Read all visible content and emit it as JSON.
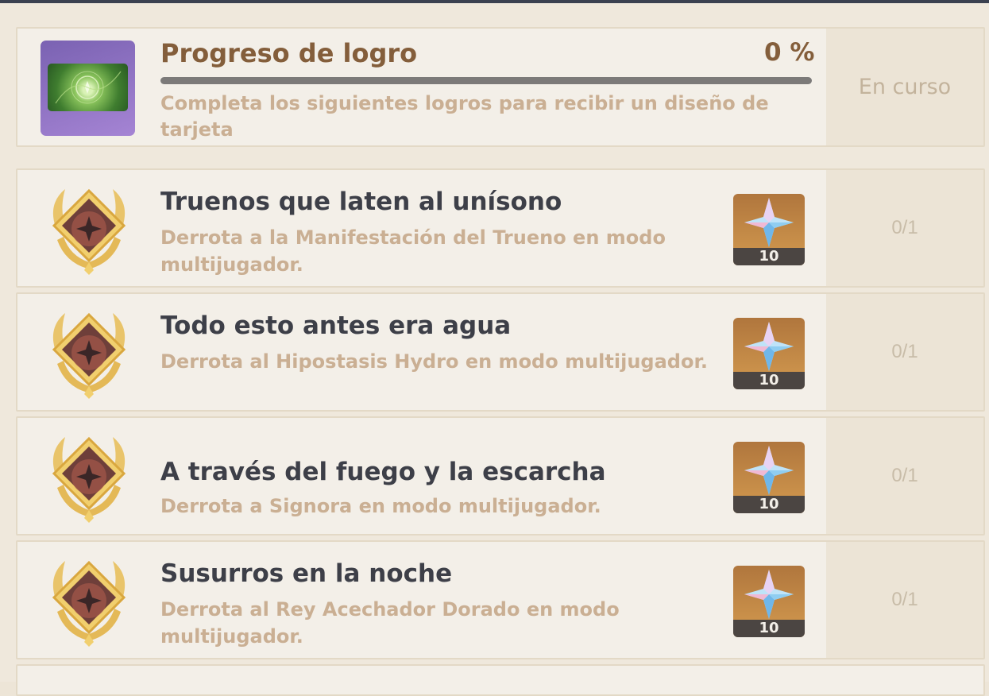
{
  "header": {
    "title": "Progreso de logro",
    "percent": "0 %",
    "progress": 0,
    "description": "Completa los siguientes logros para recibir un diseño de tarjeta",
    "status": "En curso"
  },
  "achievements": [
    {
      "title": "Truenos que laten al unísono",
      "description": "Derrota a la Manifestación del Trueno en modo multijugador.",
      "reward_qty": "10",
      "progress": "0/1"
    },
    {
      "title": "Todo esto antes era agua",
      "description": "Derrota al Hipostasis Hydro en modo multijugador.",
      "reward_qty": "10",
      "progress": "0/1"
    },
    {
      "title": "A través del fuego y la escarcha",
      "description": "Derrota a Signora en modo multijugador.",
      "reward_qty": "10",
      "progress": "0/1"
    },
    {
      "title": "Susurros en la noche",
      "description": "Derrota al Rey Acechador Dorado en modo multijugador.",
      "reward_qty": "10",
      "progress": "0/1"
    }
  ],
  "icons": {
    "namecard": "namecard-icon",
    "badge": "achievement-badge-icon",
    "reward": "primogem-icon"
  },
  "colors": {
    "title_brown": "#845e3b",
    "desc_tan": "#caaf93",
    "title_dark": "#3d3f48",
    "reward_bg": "#c88a45"
  }
}
